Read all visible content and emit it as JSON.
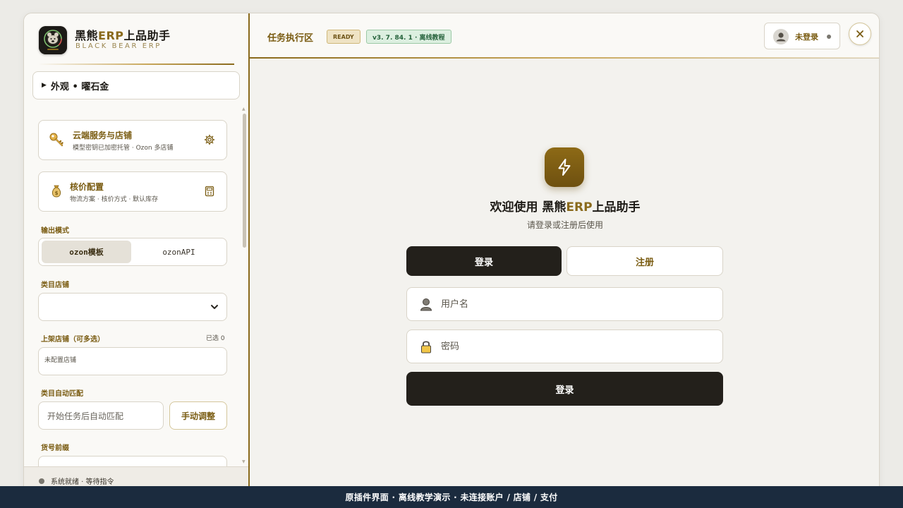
{
  "brand": {
    "title_prefix": "黑熊",
    "title_accent": "ERP",
    "title_suffix": "上品助手",
    "subtitle": "BLACK BEAR ERP",
    "logo_icon": "bear-logo-icon"
  },
  "sidebar": {
    "appearance_label": "外观 • 曜石金",
    "cards": [
      {
        "icon": "key-icon",
        "title": "云端服务与店铺",
        "subtitle": "模型密钥已加密托管 · Ozon 多店铺",
        "action_icon": "gear-icon"
      },
      {
        "icon": "money-bag-icon",
        "title": "核价配置",
        "subtitle": "物流方案 · 核价方式 · 默认库存",
        "action_icon": "calculator-icon"
      }
    ],
    "output_mode": {
      "label": "输出模式",
      "options": [
        "ozon模板",
        "ozonAPI"
      ],
      "selected": "ozon模板"
    },
    "category_shop": {
      "label": "类目店铺",
      "value": ""
    },
    "listing_shops": {
      "label": "上架店铺（可多选）",
      "count": "已选 0",
      "value": "未配置店铺"
    },
    "auto_match": {
      "label": "类目自动匹配",
      "placeholder": "开始任务后自动匹配",
      "button": "手动调整"
    },
    "sku_prefix": {
      "label": "货号前缀"
    },
    "status": {
      "text": "系统就绪 · 等待指令",
      "color": "#7a776f"
    }
  },
  "topbar": {
    "zone_title": "任务执行区",
    "ready_badge": "READY",
    "version_badge": "v3. 7. 84. 1  ·  离线教程",
    "user_label": "未登录",
    "close_icon": "close-icon"
  },
  "login": {
    "welcome_prefix": "欢迎使用 ",
    "welcome_brand": "黑熊",
    "welcome_accent": "ERP",
    "welcome_suffix": "上品助手",
    "subtitle": "请登录或注册后使用",
    "tab_login": "登录",
    "tab_register": "注册",
    "username_placeholder": "用户名",
    "password_placeholder": "密码",
    "submit_label": "登录"
  },
  "footer": {
    "text": "原插件界面 · 离线教学演示 · 未连接账户 / 店铺 / 支付"
  },
  "colors": {
    "accent_gold": "#8a6a1c",
    "dark": "#23201b",
    "footer_bg": "#1b2b3e",
    "success_green": "#24613a"
  }
}
